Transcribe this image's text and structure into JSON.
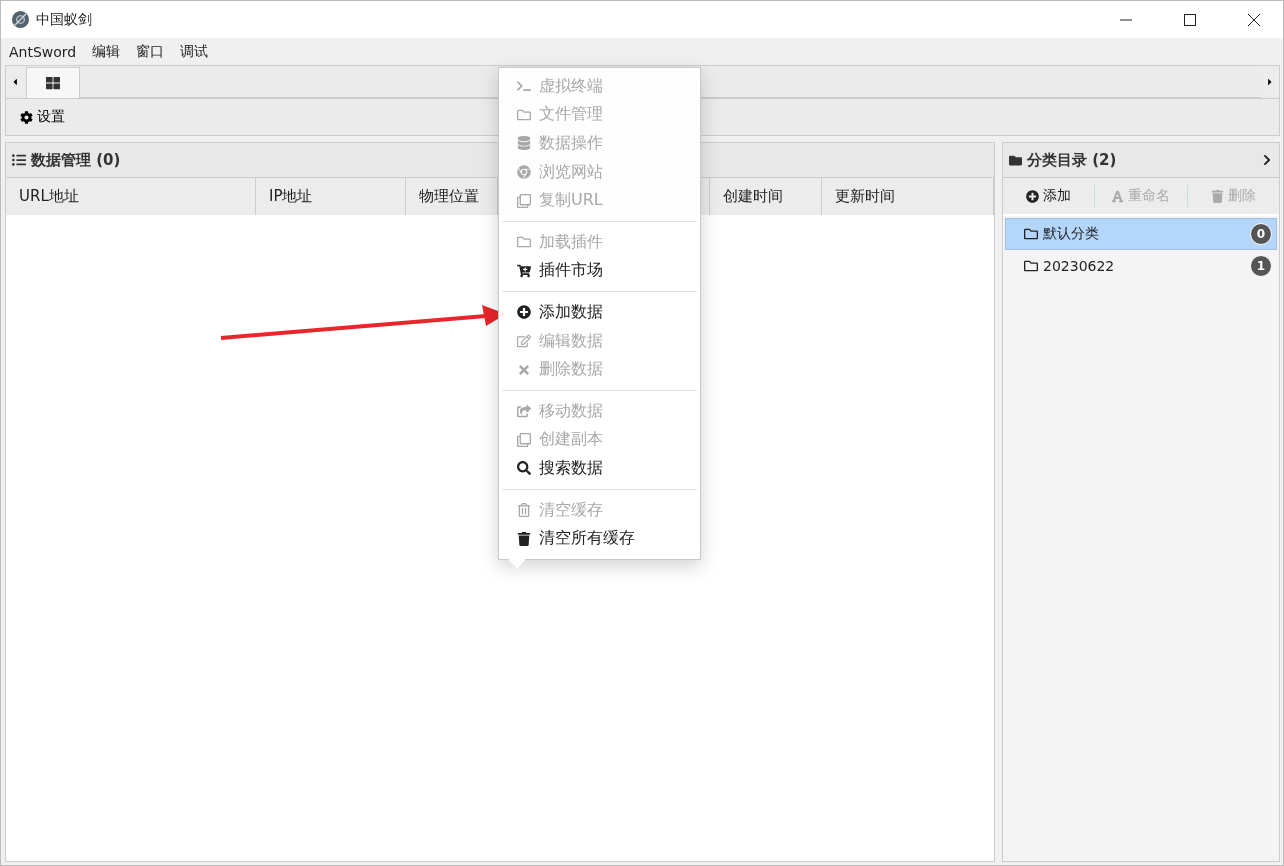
{
  "window": {
    "title": "中国蚁剑"
  },
  "menubar": [
    "AntSword",
    "编辑",
    "窗口",
    "调试"
  ],
  "toolbar": {
    "settings": "设置"
  },
  "data_panel": {
    "title": "数据管理 (0)",
    "columns": [
      "URL地址",
      "IP地址",
      "物理位置",
      "创建时间",
      "更新时间"
    ]
  },
  "category_panel": {
    "title": "分类目录 (2)",
    "actions": [
      {
        "label": "添加",
        "disabled": false
      },
      {
        "label": "重命名",
        "disabled": true
      },
      {
        "label": "删除",
        "disabled": true
      }
    ],
    "items": [
      {
        "label": "默认分类",
        "count": "0",
        "selected": true
      },
      {
        "label": "20230622",
        "count": "1",
        "selected": false
      }
    ]
  },
  "context_menu": {
    "groups": [
      [
        {
          "label": "虚拟终端",
          "disabled": true
        },
        {
          "label": "文件管理",
          "disabled": true
        },
        {
          "label": "数据操作",
          "disabled": true
        },
        {
          "label": "浏览网站",
          "disabled": true
        },
        {
          "label": "复制URL",
          "disabled": true
        }
      ],
      [
        {
          "label": "加载插件",
          "disabled": true
        },
        {
          "label": "插件市场",
          "disabled": false
        }
      ],
      [
        {
          "label": "添加数据",
          "disabled": false
        },
        {
          "label": "编辑数据",
          "disabled": true
        },
        {
          "label": "删除数据",
          "disabled": true
        }
      ],
      [
        {
          "label": "移动数据",
          "disabled": true
        },
        {
          "label": "创建副本",
          "disabled": true
        },
        {
          "label": "搜索数据",
          "disabled": false
        }
      ],
      [
        {
          "label": "清空缓存",
          "disabled": true
        },
        {
          "label": "清空所有缓存",
          "disabled": false
        }
      ]
    ]
  }
}
